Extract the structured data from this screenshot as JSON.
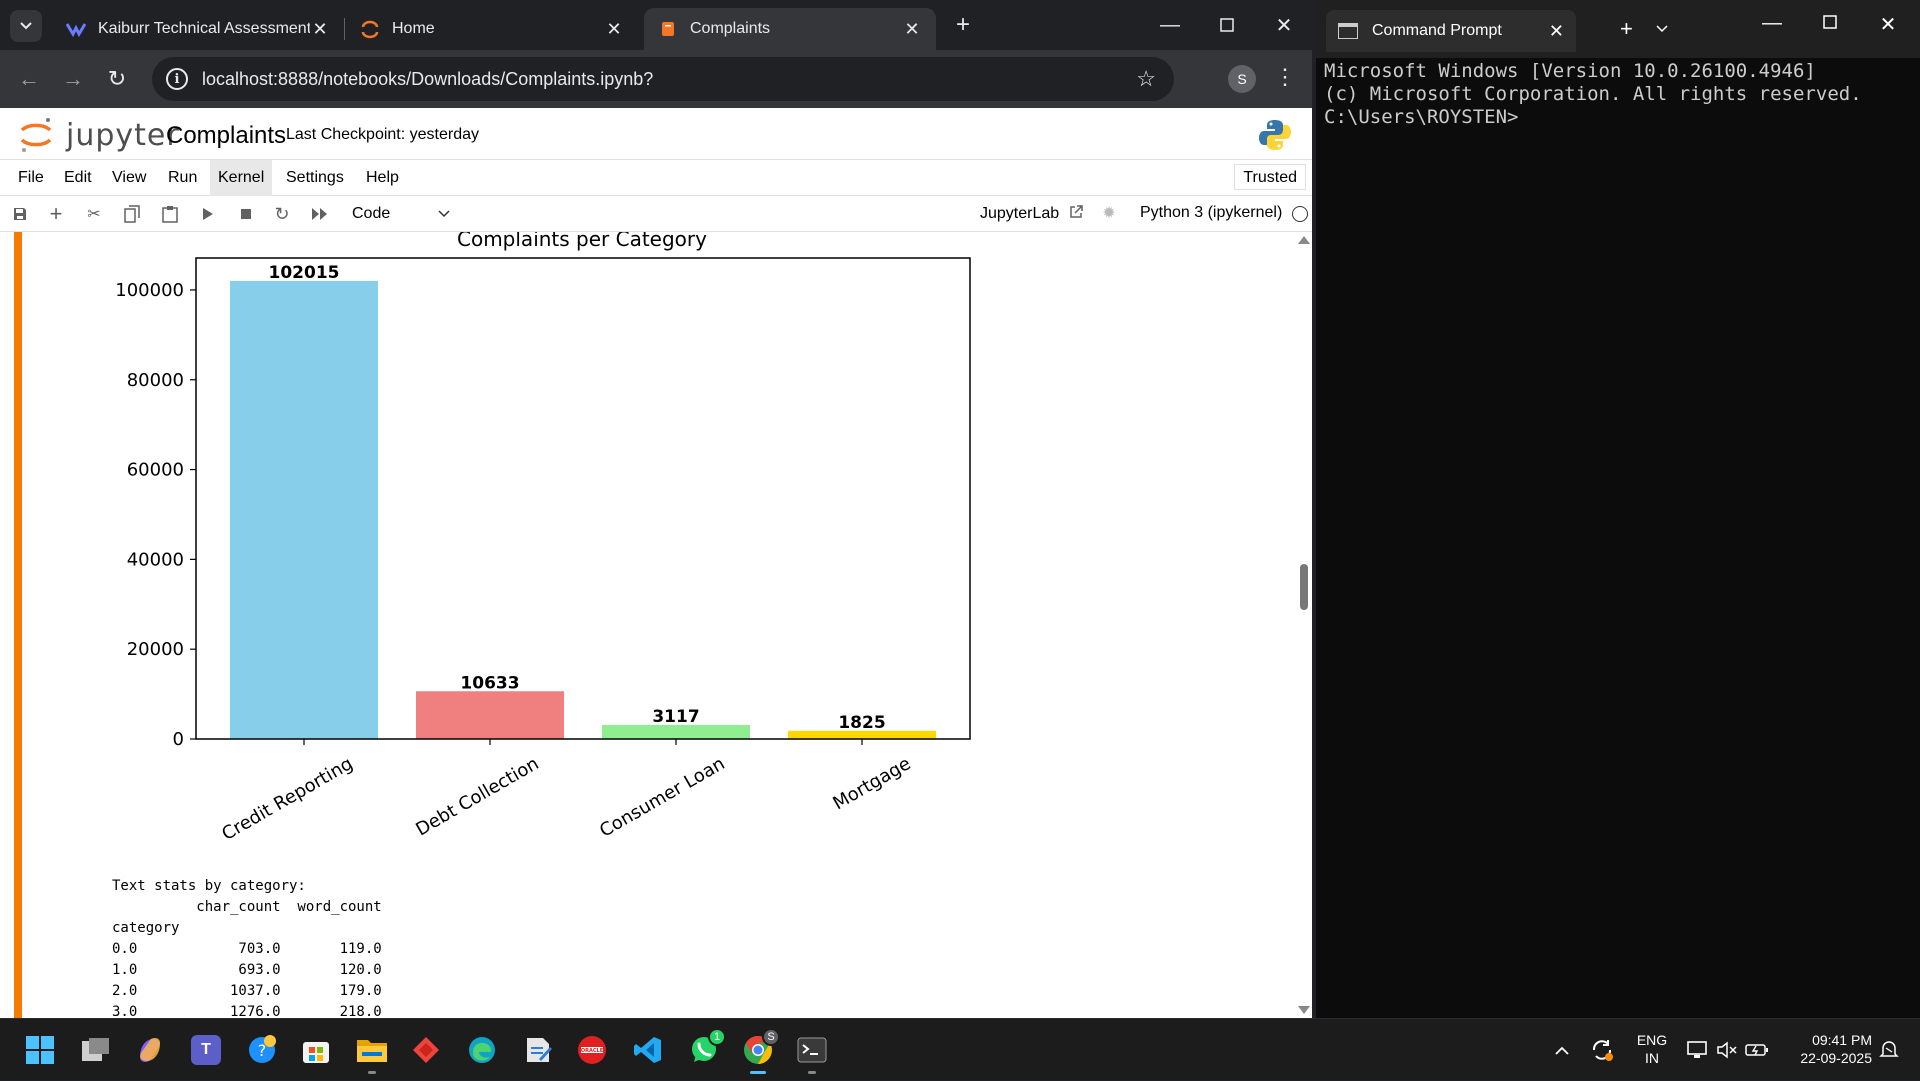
{
  "browser": {
    "tabs": [
      {
        "title": "Kaiburr Technical Assessment O",
        "icon": "kaiburr-icon",
        "active": false
      },
      {
        "title": "Home",
        "icon": "jupyter-icon",
        "active": false
      },
      {
        "title": "Complaints",
        "icon": "notebook-icon",
        "active": true
      }
    ],
    "url": "localhost:8888/notebooks/Downloads/Complaints.ipynb?",
    "profile_initial": "S"
  },
  "jupyter": {
    "logo_text": "jupyter",
    "notebook_title": "Complaints",
    "checkpoint": "Last Checkpoint: yesterday",
    "menu": [
      "File",
      "Edit",
      "View",
      "Run",
      "Kernel",
      "Settings",
      "Help"
    ],
    "trusted_label": "Trusted",
    "cell_type": "Code",
    "jupyterlab_label": "JupyterLab",
    "kernel": "Python 3 (ipykernel)"
  },
  "chart_data": {
    "type": "bar",
    "title": "Complaints per Category",
    "categories": [
      "Credit Reporting",
      "Debt Collection",
      "Consumer Loan",
      "Mortgage"
    ],
    "values": [
      102015,
      10633,
      3117,
      1825
    ],
    "colors": [
      "#87ceeb",
      "#f08080",
      "#90ee90",
      "#ffd700"
    ],
    "data_labels": [
      "102015",
      "10633",
      "3117",
      "1825"
    ],
    "yticks": [
      0,
      20000,
      40000,
      60000,
      80000,
      100000
    ],
    "ytick_labels": [
      "0",
      "20000",
      "40000",
      "60000",
      "80000",
      "100000"
    ],
    "ylim": [
      0,
      107116
    ],
    "xlabel": "",
    "ylabel": "",
    "grid": false,
    "xtick_rotation": 30
  },
  "stats_output": {
    "heading": "Text stats by category:",
    "columns": [
      "char_count",
      "word_count"
    ],
    "index_name": "category",
    "rows": [
      {
        "category": "0.0",
        "char_count": "703.0",
        "word_count": "119.0"
      },
      {
        "category": "1.0",
        "char_count": "693.0",
        "word_count": "120.0"
      },
      {
        "category": "2.0",
        "char_count": "1037.0",
        "word_count": "179.0"
      },
      {
        "category": "3.0",
        "char_count": "1276.0",
        "word_count": "218.0"
      }
    ]
  },
  "cmd": {
    "tab_title": "Command Prompt",
    "lines": [
      "Microsoft Windows [Version 10.0.26100.4946]",
      "(c) Microsoft Corporation. All rights reserved.",
      "",
      "C:\\Users\\ROYSTEN>"
    ]
  },
  "taskbar": {
    "apps": [
      {
        "name": "start-icon",
        "color": "#4cc2ff"
      },
      {
        "name": "task-view-icon",
        "color": "#cfcfcf"
      },
      {
        "name": "copilot-icon",
        "color": "#7b61ff"
      },
      {
        "name": "teams-icon",
        "color": "#5b5fc7"
      },
      {
        "name": "edge-beta-icon",
        "color": "#1e90ff"
      },
      {
        "name": "store-icon",
        "color": "#f3f3f3"
      },
      {
        "name": "file-explorer-icon",
        "color": "#ffc83d"
      },
      {
        "name": "anydesk-icon",
        "color": "#ef443b"
      },
      {
        "name": "edge-icon",
        "color": "#0fa4c4"
      },
      {
        "name": "notepad-icon",
        "color": "#e6e6e6"
      },
      {
        "name": "oracle-icon",
        "color": "#e02020"
      },
      {
        "name": "vscode-icon",
        "color": "#23a9f2"
      },
      {
        "name": "whatsapp-icon",
        "color": "#25d366"
      },
      {
        "name": "chrome-icon",
        "color": "#34a853"
      },
      {
        "name": "terminal-icon",
        "color": "#3a3a3a"
      }
    ],
    "whatsapp_badge": "1",
    "language": "ENG",
    "region": "IN",
    "time": "09:41 PM",
    "date": "22-09-2025"
  }
}
